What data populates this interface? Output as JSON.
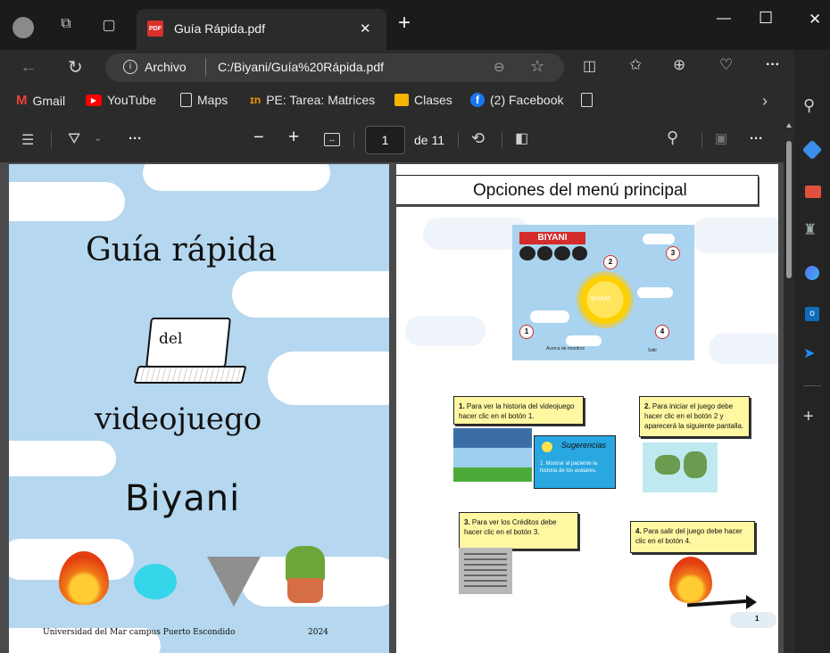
{
  "browser": {
    "tab_title": "Guía Rápida.pdf",
    "tab_close": "✕",
    "new_tab": "+",
    "window_minimize": "—",
    "window_maximize": "☐",
    "window_close": "✕",
    "address_label": "Archivo",
    "address_url": "C:/Biyani/Guía%20Rápida.pdf",
    "menu_dots": "···"
  },
  "bookmarks": [
    {
      "label": "Gmail",
      "icon": "gmail-icon",
      "color": "#ea4335"
    },
    {
      "label": "YouTube",
      "icon": "youtube-icon",
      "color": "#ff0000"
    },
    {
      "label": "Maps",
      "icon": "page-icon"
    },
    {
      "label": "PE: Tarea: Matrices",
      "icon": "classroom-icon",
      "color": "#f29900"
    },
    {
      "label": "Clases",
      "icon": "classes-icon",
      "color": "#f4b400"
    },
    {
      "label": "(2) Facebook",
      "icon": "facebook-icon",
      "color": "#1877f2"
    }
  ],
  "pdf_toolbar": {
    "minus": "−",
    "plus": "+",
    "current_page": "1",
    "total_pages": "de 11",
    "dots": "···"
  },
  "page1": {
    "title": "Guía rápida",
    "del": "del",
    "videojuego": "videojuego",
    "biyani": "Biyani",
    "footer_left": "Universidad del Mar campus Puerto Escondido",
    "footer_right": "2024"
  },
  "page2": {
    "header": "Opciones del menú principal",
    "game_title": "BIYANI",
    "sun_label": "BIYANI",
    "markers": [
      "1",
      "2",
      "3",
      "4"
    ],
    "label_about": "Acerca de\nnosotros",
    "label_exit": "Salir",
    "note1_num": "1.",
    "note1": "Para ver la historia del videojuego hacer clic en el botón 1.",
    "note2_num": "2.",
    "note2": "Para iniciar el juego debe hacer clic en el botón 2 y aparecerá la siguiente pantalla.",
    "note3_num": "3.",
    "note3": "Para ver los Créditos debe hacer clic en el botón 3.",
    "note4_num": "4.",
    "note4": "Para salir del juego debe hacer clic en el botón 4.",
    "sugerencias_title": "Sugerencias",
    "sugerencias_text": "1. Mostrar al paciente la historia de los avatares.",
    "page_number": "1"
  },
  "colors": {
    "page1_bg": "#b5d7ef",
    "note_bg": "#fff7a1",
    "sugerencias_bg": "#29a7e1"
  }
}
